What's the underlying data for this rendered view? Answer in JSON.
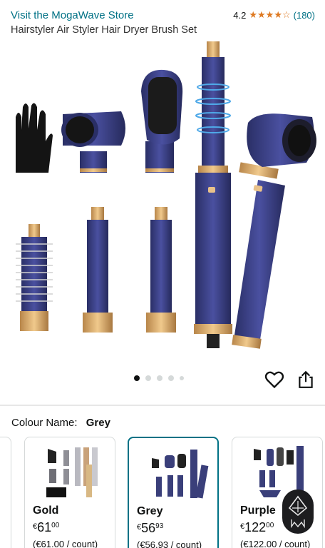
{
  "header": {
    "store_link": "Visit the MogaWave Store",
    "rating_value": "4.2",
    "rating_stars": "★★★★☆",
    "rating_count": "(180)",
    "product_title": "Hairstyler Air Styler Hair Dryer Brush Set"
  },
  "gallery": {
    "page_count": 5,
    "current_page": 1
  },
  "colour": {
    "label": "Colour Name:",
    "selected": "Grey"
  },
  "swatches": [
    {
      "name": "Gold",
      "currency": "€",
      "whole": "61",
      "fraction": "00",
      "unit": "(€61.00 / count)"
    },
    {
      "name": "Grey",
      "currency": "€",
      "whole": "56",
      "fraction": "93",
      "unit": "(€56.93 / count)"
    },
    {
      "name": "Purple",
      "currency": "€",
      "whole": "122",
      "fraction": "00",
      "unit": "(€122.00 / count)"
    }
  ],
  "colors": {
    "link": "#007185",
    "star": "#de7921",
    "selected_border": "#007185",
    "device_navy": "#3a3f7a",
    "accent_gold": "#d4a86a"
  },
  "icons": [
    "heart-icon",
    "share-icon"
  ]
}
